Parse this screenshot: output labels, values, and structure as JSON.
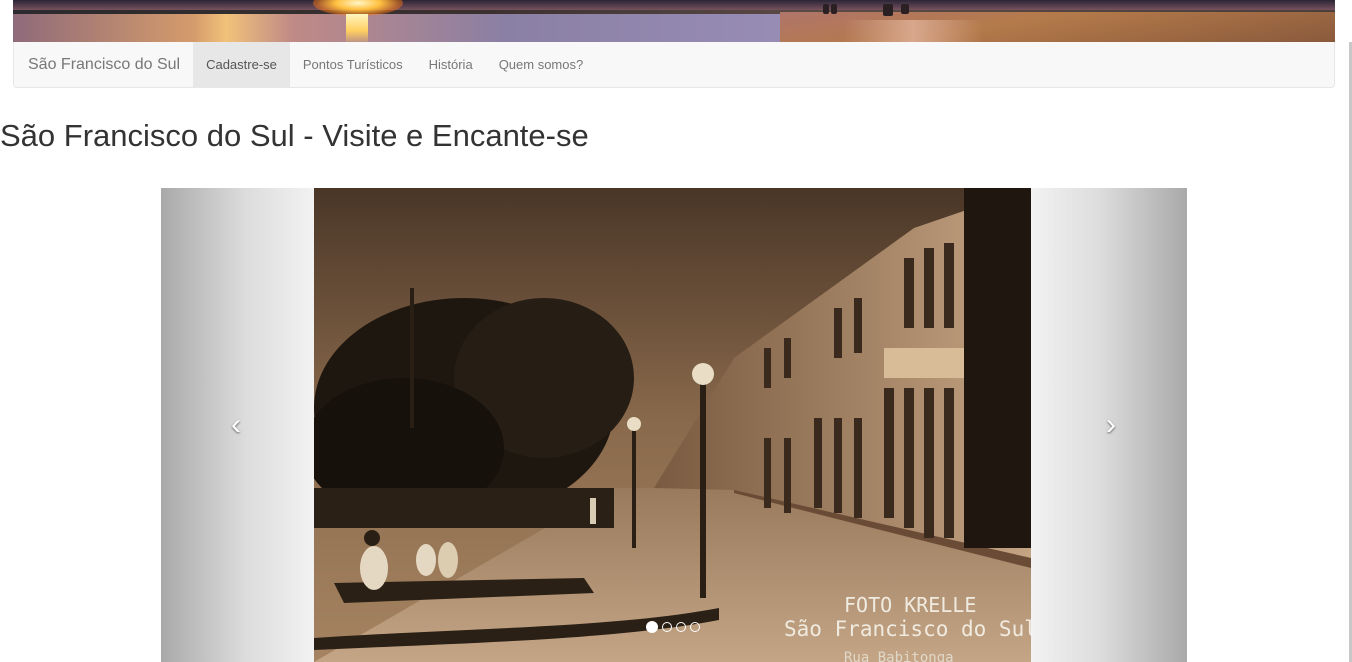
{
  "navbar": {
    "brand": "São Francisco do Sul",
    "items": [
      {
        "label": "Cadastre-se",
        "active": true
      },
      {
        "label": "Pontos Turísticos",
        "active": false
      },
      {
        "label": "História",
        "active": false
      },
      {
        "label": "Quem somos?",
        "active": false
      }
    ]
  },
  "heading": "São Francisco do Sul - Visite e Encante-se",
  "carousel": {
    "slide_caption": {
      "line1": "FOTO KRELLE",
      "line2": "São Francisco do Sul",
      "line3": "Rua Babitonga"
    },
    "slide_count": 4,
    "active_index": 0,
    "prev_icon": "chevron-left-icon",
    "next_icon": "chevron-right-icon"
  },
  "colors": {
    "navbar_bg": "#f8f8f8",
    "navbar_active_bg": "#e7e7e7",
    "nav_text": "#777777",
    "heading_text": "#333333"
  }
}
